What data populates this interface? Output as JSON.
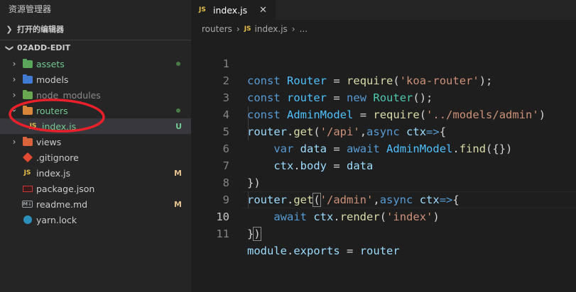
{
  "sidebar": {
    "title": "资源管理器",
    "sections": {
      "open_editors": "打开的编辑器",
      "project": "02ADD-EDIT"
    },
    "items": [
      {
        "name": "assets",
        "type": "folder",
        "color": "#73c991",
        "status": "dot"
      },
      {
        "name": "models",
        "type": "folder",
        "color": "#cccccc",
        "status": ""
      },
      {
        "name": "node_modules",
        "type": "folder",
        "color": "#8b8b8b",
        "status": ""
      },
      {
        "name": "routers",
        "type": "folder",
        "color": "#73c991",
        "status": "dot",
        "expanded": true
      },
      {
        "name": "index.js",
        "type": "file",
        "color": "#73c991",
        "status": "U",
        "child": true,
        "selected": true
      },
      {
        "name": "views",
        "type": "folder",
        "color": "#cccccc",
        "status": ""
      },
      {
        "name": ".gitignore",
        "type": "file",
        "color": "#cccccc",
        "status": ""
      },
      {
        "name": "index.js",
        "type": "file",
        "color": "#e2c08d",
        "status": "M"
      },
      {
        "name": "package.json",
        "type": "file",
        "color": "#cccccc",
        "status": ""
      },
      {
        "name": "readme.md",
        "type": "file",
        "color": "#e2c08d",
        "status": "M"
      },
      {
        "name": "yarn.lock",
        "type": "file",
        "color": "#cccccc",
        "status": ""
      }
    ]
  },
  "editor": {
    "tab": {
      "icon_text": "JS",
      "label": "index.js",
      "close": "✕"
    },
    "breadcrumb": {
      "folder": "routers",
      "sep": "›",
      "icon_text": "JS",
      "file": "index.js",
      "sep2": "›",
      "more": "..."
    },
    "line_numbers": [
      "1",
      "2",
      "3",
      "4",
      "5",
      "6",
      "7",
      "8",
      "9",
      "10",
      "11"
    ],
    "current_line": 10
  },
  "colors": {
    "annotation": "#e8202a",
    "js_icon": "#e8c14a",
    "modified": "#e2c08d",
    "untracked": "#73c991"
  }
}
